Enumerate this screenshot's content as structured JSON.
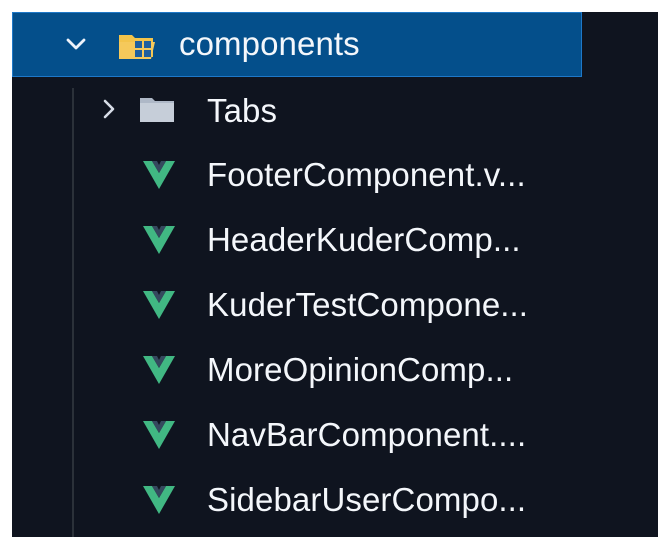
{
  "explorer": {
    "folder": {
      "name": "components",
      "expanded": true,
      "icon": "folder-open-components-icon",
      "icon_color": "#f6c54b"
    },
    "subfolder": {
      "name": "Tabs",
      "expanded": false,
      "icon": "folder-icon",
      "icon_color": "#b0bac8"
    },
    "files": [
      {
        "label": "FooterComponent.v...",
        "icon": "vue-icon"
      },
      {
        "label": "HeaderKuderComp...",
        "icon": "vue-icon"
      },
      {
        "label": "KuderTestCompone...",
        "icon": "vue-icon"
      },
      {
        "label": "MoreOpinionComp...",
        "icon": "vue-icon"
      },
      {
        "label": "NavBarComponent....",
        "icon": "vue-icon"
      },
      {
        "label": "SidebarUserCompo...",
        "icon": "vue-icon"
      }
    ],
    "colors": {
      "background": "#0f141f",
      "selected_background": "#044f8b",
      "selected_border": "#1e78c8",
      "vue_green": "#41b883",
      "text": "#f3f6fb"
    }
  }
}
